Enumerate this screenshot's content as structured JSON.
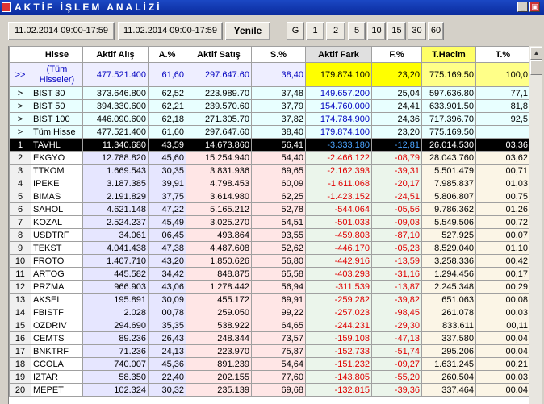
{
  "window": {
    "title": "AKTİF İŞLEM ANALİZİ",
    "min_glyph": "_",
    "close_glyph": "▣"
  },
  "toolbar": {
    "start_time": "11.02.2014 09:00-17:59",
    "end_time": "11.02.2014 09:00-17:59",
    "refresh_label": "Yenile",
    "g_label": "G",
    "periods": [
      "1",
      "2",
      "5",
      "10",
      "15",
      "30",
      "60"
    ]
  },
  "columns": {
    "hisse": "Hisse",
    "aktif_alis": "Aktif Alış",
    "a_pct": "A.%",
    "aktif_satis": "Aktif Satış",
    "s_pct": "S.%",
    "aktif_fark": "Aktif Fark",
    "f_pct": "F.%",
    "t_hacim": "T.Hacim",
    "t_pct": "T.%"
  },
  "total_row": {
    "marker": ">>",
    "name": "(Tüm Hisseler)",
    "aktif_alis": "477.521.400",
    "a_pct": "61,60",
    "aktif_satis": "297.647.60",
    "s_pct": "38,40",
    "aktif_fark": "179.874.100",
    "f_pct": "23,20",
    "t_hacim": "775.169.50",
    "t_pct": "100,0"
  },
  "index_rows": [
    {
      "marker": ">",
      "name": "BIST 30",
      "aktif_alis": "373.646.800",
      "a_pct": "62,52",
      "aktif_satis": "223.989.70",
      "s_pct": "37,48",
      "aktif_fark": "149.657.200",
      "f_pct": "25,04",
      "t_hacim": "597.636.80",
      "t_pct": "77,1"
    },
    {
      "marker": ">",
      "name": "BIST 50",
      "aktif_alis": "394.330.600",
      "a_pct": "62,21",
      "aktif_satis": "239.570.60",
      "s_pct": "37,79",
      "aktif_fark": "154.760.000",
      "f_pct": "24,41",
      "t_hacim": "633.901.50",
      "t_pct": "81,8"
    },
    {
      "marker": ">",
      "name": "BIST 100",
      "aktif_alis": "446.090.600",
      "a_pct": "62,18",
      "aktif_satis": "271.305.70",
      "s_pct": "37,82",
      "aktif_fark": "174.784.900",
      "f_pct": "24,36",
      "t_hacim": "717.396.70",
      "t_pct": "92,5"
    },
    {
      "marker": ">",
      "name": "Tüm Hisse",
      "aktif_alis": "477.521.400",
      "a_pct": "61,60",
      "aktif_satis": "297.647.60",
      "s_pct": "38,40",
      "aktif_fark": "179.874.100",
      "f_pct": "23,20",
      "t_hacim": "775.169.50",
      "t_pct": ""
    }
  ],
  "stock_rows": [
    {
      "idx": "1",
      "name": "TAVHL",
      "aktif_alis": "11.340.680",
      "a_pct": "43,59",
      "aktif_satis": "14.673.860",
      "s_pct": "56,41",
      "aktif_fark": "-3.333.180",
      "f_pct": "-12,81",
      "t_hacim": "26.014.530",
      "t_pct": "03,36"
    },
    {
      "idx": "2",
      "name": "EKGYO",
      "aktif_alis": "12.788.820",
      "a_pct": "45,60",
      "aktif_satis": "15.254.940",
      "s_pct": "54,40",
      "aktif_fark": "-2.466.122",
      "f_pct": "-08,79",
      "t_hacim": "28.043.760",
      "t_pct": "03,62"
    },
    {
      "idx": "3",
      "name": "TTKOM",
      "aktif_alis": "1.669.543",
      "a_pct": "30,35",
      "aktif_satis": "3.831.936",
      "s_pct": "69,65",
      "aktif_fark": "-2.162.393",
      "f_pct": "-39,31",
      "t_hacim": "5.501.479",
      "t_pct": "00,71"
    },
    {
      "idx": "4",
      "name": "IPEKE",
      "aktif_alis": "3.187.385",
      "a_pct": "39,91",
      "aktif_satis": "4.798.453",
      "s_pct": "60,09",
      "aktif_fark": "-1.611.068",
      "f_pct": "-20,17",
      "t_hacim": "7.985.837",
      "t_pct": "01,03"
    },
    {
      "idx": "5",
      "name": "BIMAS",
      "aktif_alis": "2.191.829",
      "a_pct": "37,75",
      "aktif_satis": "3.614.980",
      "s_pct": "62,25",
      "aktif_fark": "-1.423.152",
      "f_pct": "-24,51",
      "t_hacim": "5.806.807",
      "t_pct": "00,75"
    },
    {
      "idx": "6",
      "name": "SAHOL",
      "aktif_alis": "4.621.148",
      "a_pct": "47,22",
      "aktif_satis": "5.165.212",
      "s_pct": "52,78",
      "aktif_fark": "-544.064",
      "f_pct": "-05,56",
      "t_hacim": "9.786.362",
      "t_pct": "01,26"
    },
    {
      "idx": "7",
      "name": "KOZAL",
      "aktif_alis": "2.524.237",
      "a_pct": "45,49",
      "aktif_satis": "3.025.270",
      "s_pct": "54,51",
      "aktif_fark": "-501.033",
      "f_pct": "-09,03",
      "t_hacim": "5.549.506",
      "t_pct": "00,72"
    },
    {
      "idx": "8",
      "name": "USDTRF",
      "aktif_alis": "34.061",
      "a_pct": "06,45",
      "aktif_satis": "493.864",
      "s_pct": "93,55",
      "aktif_fark": "-459.803",
      "f_pct": "-87,10",
      "t_hacim": "527.925",
      "t_pct": "00,07"
    },
    {
      "idx": "9",
      "name": "TEKST",
      "aktif_alis": "4.041.438",
      "a_pct": "47,38",
      "aktif_satis": "4.487.608",
      "s_pct": "52,62",
      "aktif_fark": "-446.170",
      "f_pct": "-05,23",
      "t_hacim": "8.529.040",
      "t_pct": "01,10"
    },
    {
      "idx": "10",
      "name": "FROTO",
      "aktif_alis": "1.407.710",
      "a_pct": "43,20",
      "aktif_satis": "1.850.626",
      "s_pct": "56,80",
      "aktif_fark": "-442.916",
      "f_pct": "-13,59",
      "t_hacim": "3.258.336",
      "t_pct": "00,42"
    },
    {
      "idx": "11",
      "name": "ARTOG",
      "aktif_alis": "445.582",
      "a_pct": "34,42",
      "aktif_satis": "848.875",
      "s_pct": "65,58",
      "aktif_fark": "-403.293",
      "f_pct": "-31,16",
      "t_hacim": "1.294.456",
      "t_pct": "00,17"
    },
    {
      "idx": "12",
      "name": "PRZMA",
      "aktif_alis": "966.903",
      "a_pct": "43,06",
      "aktif_satis": "1.278.442",
      "s_pct": "56,94",
      "aktif_fark": "-311.539",
      "f_pct": "-13,87",
      "t_hacim": "2.245.348",
      "t_pct": "00,29"
    },
    {
      "idx": "13",
      "name": "AKSEL",
      "aktif_alis": "195.891",
      "a_pct": "30,09",
      "aktif_satis": "455.172",
      "s_pct": "69,91",
      "aktif_fark": "-259.282",
      "f_pct": "-39,82",
      "t_hacim": "651.063",
      "t_pct": "00,08"
    },
    {
      "idx": "14",
      "name": "FBISTF",
      "aktif_alis": "2.028",
      "a_pct": "00,78",
      "aktif_satis": "259.050",
      "s_pct": "99,22",
      "aktif_fark": "-257.023",
      "f_pct": "-98,45",
      "t_hacim": "261.078",
      "t_pct": "00,03"
    },
    {
      "idx": "15",
      "name": "OZDRIV",
      "aktif_alis": "294.690",
      "a_pct": "35,35",
      "aktif_satis": "538.922",
      "s_pct": "64,65",
      "aktif_fark": "-244.231",
      "f_pct": "-29,30",
      "t_hacim": "833.611",
      "t_pct": "00,11"
    },
    {
      "idx": "16",
      "name": "CEMTS",
      "aktif_alis": "89.236",
      "a_pct": "26,43",
      "aktif_satis": "248.344",
      "s_pct": "73,57",
      "aktif_fark": "-159.108",
      "f_pct": "-47,13",
      "t_hacim": "337.580",
      "t_pct": "00,04"
    },
    {
      "idx": "17",
      "name": "BNKTRF",
      "aktif_alis": "71.236",
      "a_pct": "24,13",
      "aktif_satis": "223.970",
      "s_pct": "75,87",
      "aktif_fark": "-152.733",
      "f_pct": "-51,74",
      "t_hacim": "295.206",
      "t_pct": "00,04"
    },
    {
      "idx": "18",
      "name": "CCOLA",
      "aktif_alis": "740.007",
      "a_pct": "45,36",
      "aktif_satis": "891.239",
      "s_pct": "54,64",
      "aktif_fark": "-151.232",
      "f_pct": "-09,27",
      "t_hacim": "1.631.245",
      "t_pct": "00,21"
    },
    {
      "idx": "19",
      "name": "IZTAR",
      "aktif_alis": "58.350",
      "a_pct": "22,40",
      "aktif_satis": "202.155",
      "s_pct": "77,60",
      "aktif_fark": "-143.805",
      "f_pct": "-55,20",
      "t_hacim": "260.504",
      "t_pct": "00,03"
    },
    {
      "idx": "20",
      "name": "MEPET",
      "aktif_alis": "102.324",
      "a_pct": "30,32",
      "aktif_satis": "235.139",
      "s_pct": "69,68",
      "aktif_fark": "-132.815",
      "f_pct": "-39,36",
      "t_hacim": "337.464",
      "t_pct": "00,04"
    }
  ],
  "selected_row": 1
}
